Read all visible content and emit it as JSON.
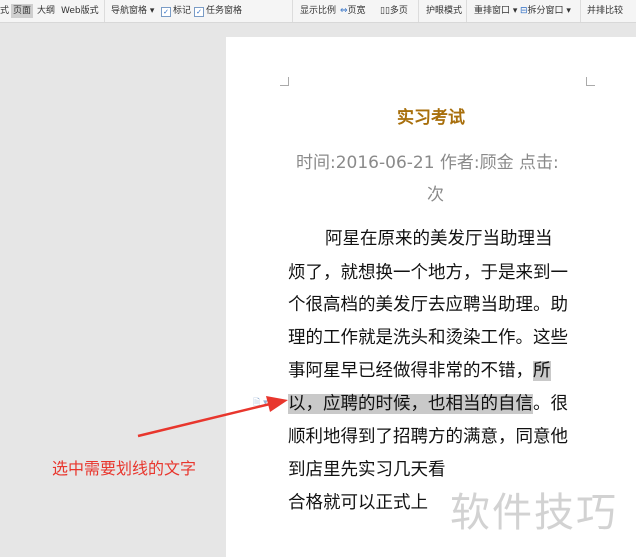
{
  "toolbar": {
    "items": [
      "式",
      "页面",
      "大纲",
      "Web版式",
      "导航窗格",
      "标记",
      "任务窗格",
      "显示比例",
      "页宽",
      "多页",
      "护眼模式",
      "重排窗口",
      "拆分窗口",
      "并排比较"
    ]
  },
  "document": {
    "title": "实习考试",
    "meta_line1": "时间:2016-06-21  作者:顾金  点击:",
    "meta_line2": "次",
    "lines": [
      "阿星在原来的美发厅当助理当",
      "烦了，就想换一个地方，于是来到一",
      "个很高档的美发厅去应聘当助理。助",
      "理的工作就是洗头和烫染工作。这些",
      "事阿星早已经做得非常的不错，",
      "所",
      "以，应聘的时候，也相当的自信",
      "。很",
      "顺利地得到了招聘方的满意，同意他",
      "到店里先实习几天看",
      "合格就可以正式上"
    ]
  },
  "annotation": {
    "label": "选中需要划线的文字"
  },
  "watermark": "软件技巧"
}
